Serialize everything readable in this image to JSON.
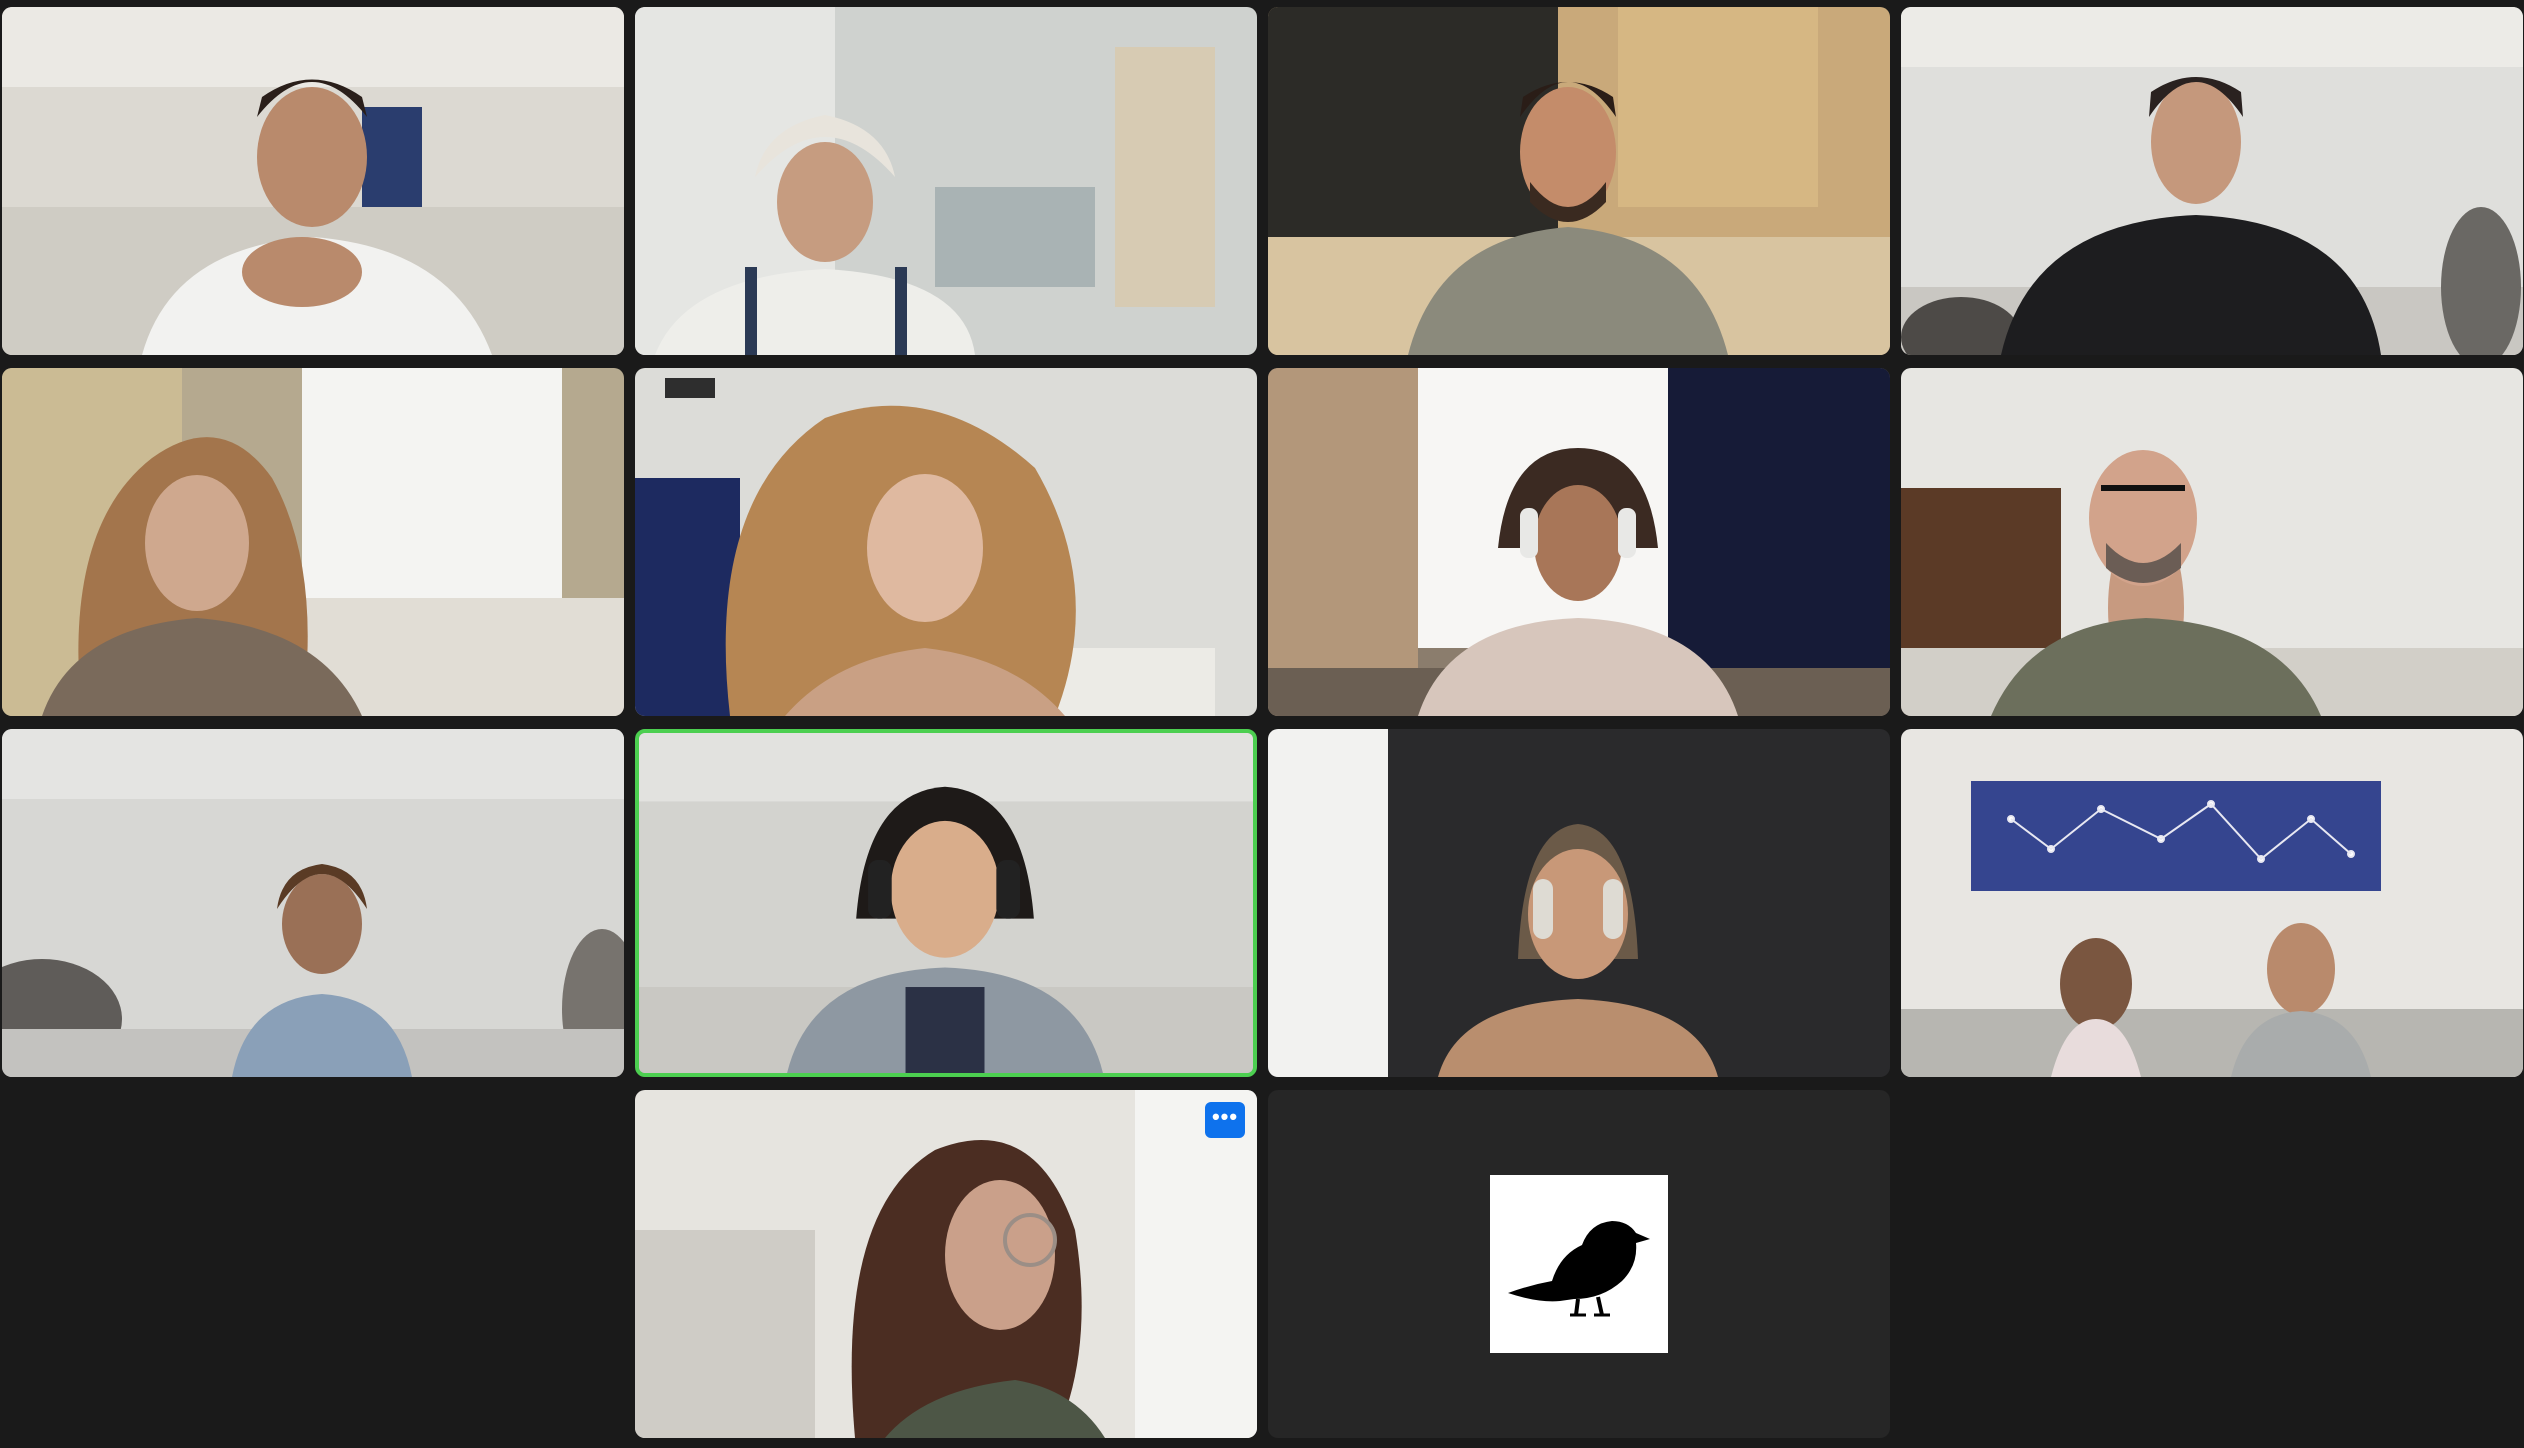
{
  "meeting": {
    "view": "gallery",
    "active_speaker_index": 9,
    "more_options_label": "•••"
  },
  "participants": [
    {
      "id": "p1",
      "video": "on"
    },
    {
      "id": "p2",
      "video": "on"
    },
    {
      "id": "p3",
      "video": "on"
    },
    {
      "id": "p4",
      "video": "on"
    },
    {
      "id": "p5",
      "video": "on"
    },
    {
      "id": "p6",
      "video": "on"
    },
    {
      "id": "p7",
      "video": "on"
    },
    {
      "id": "p8",
      "video": "on"
    },
    {
      "id": "p9",
      "video": "on"
    },
    {
      "id": "p10",
      "video": "on",
      "speaking": true
    },
    {
      "id": "p11",
      "video": "on"
    },
    {
      "id": "p12",
      "video": "on"
    },
    {
      "id": "p13",
      "video": "on"
    },
    {
      "id": "p14",
      "video": "off",
      "avatar_icon": "bird-silhouette-icon"
    }
  ],
  "colors": {
    "background": "#1a1a1a",
    "active_speaker_border": "#4ccf50",
    "more_button": "#0e72ed",
    "video_off_tile": "#262626"
  }
}
